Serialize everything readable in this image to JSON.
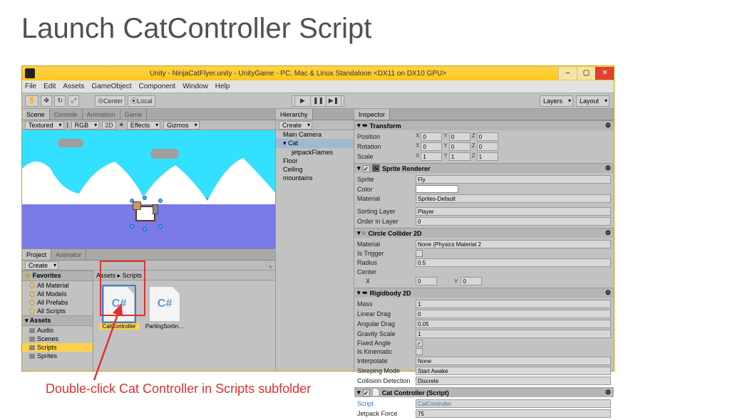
{
  "slide": {
    "title": "Launch CatController Script"
  },
  "window": {
    "title": "Unity - NinjaCatFlyer.unity - UnityGame - PC, Mac & Linux Standalone <DX11 on DX10 GPU>"
  },
  "menu": [
    "File",
    "Edit",
    "Assets",
    "GameObject",
    "Component",
    "Window",
    "Help"
  ],
  "toolbar": {
    "center": "Center",
    "local": "Local",
    "layers": "Layers",
    "layout": "Layout"
  },
  "scene_tabs": {
    "scene": "Scene",
    "console": "Console",
    "anim": "Animation",
    "game": "Game"
  },
  "scene_tb": {
    "textured": "Textured",
    "rgb": "RGB",
    "d2": "2D",
    "effects": "Effects",
    "gizmos": "Gizmos"
  },
  "hierarchy": {
    "title": "Hierarchy",
    "create": "Create",
    "items": [
      "Main Camera",
      "Cat",
      "jetpackFlames",
      "Floor",
      "Ceiling",
      "mountains"
    ]
  },
  "project": {
    "tab_project": "Project",
    "tab_animator": "Animator",
    "create": "Create",
    "favorites": "Favorites",
    "fav_items": [
      "All Material",
      "All Models",
      "All Prefabs",
      "All Scripts"
    ],
    "assets": "Assets",
    "asset_items": [
      "Audio",
      "Scenes",
      "Scripts",
      "Sprites"
    ],
    "breadcrumb": "Assets ▸ Scripts",
    "files": [
      {
        "name": "CatController",
        "icon": "C#"
      },
      {
        "name": "PartingSortin…",
        "icon": "C#"
      }
    ]
  },
  "inspector": {
    "title": "Inspector",
    "transform": {
      "hdr": "Transform",
      "rows": [
        {
          "label": "Position",
          "x": "0",
          "y": "0",
          "z": "0"
        },
        {
          "label": "Rotation",
          "x": "0",
          "y": "0",
          "z": "0"
        },
        {
          "label": "Scale",
          "x": "1",
          "y": "1",
          "z": "1"
        }
      ]
    },
    "sprite": {
      "hdr": "Sprite Renderer",
      "sprite": "Fly",
      "color_lbl": "Color",
      "material": "Sprites-Default",
      "sorting": "Player",
      "order": "0",
      "sprite_lbl": "Sprite",
      "mat_lbl": "Material",
      "sort_lbl": "Sorting Layer",
      "order_lbl": "Order in Layer"
    },
    "collider": {
      "hdr": "Circle Collider 2D",
      "material": "None (Physics Material 2",
      "mat_lbl": "Material",
      "trig_lbl": "Is Trigger",
      "radius_lbl": "Radius",
      "radius": "0.5",
      "center_lbl": "Center",
      "cx": "0",
      "cy": "0"
    },
    "rigid": {
      "hdr": "Rigidbody 2D",
      "rows": [
        {
          "label": "Mass",
          "val": "1"
        },
        {
          "label": "Linear Drag",
          "val": "0"
        },
        {
          "label": "Angular Drag",
          "val": "0.05"
        },
        {
          "label": "Gravity Scale",
          "val": "1"
        }
      ],
      "fixed": "Fixed Angle",
      "kin": "Is Kinematic",
      "interp": "Interpolate",
      "interp_v": "None",
      "sleep": "Sleeping Mode",
      "sleep_v": "Start Awake",
      "coll": "Collision Detection",
      "coll_v": "Discrete"
    },
    "script": {
      "hdr": "Cat Controller (Script)",
      "script_lbl": "Script",
      "script_v": "CatController",
      "force_lbl": "Jetpack Force",
      "force_v": "75"
    }
  },
  "annotation": "Double-click Cat Controller in Scripts subfolder"
}
